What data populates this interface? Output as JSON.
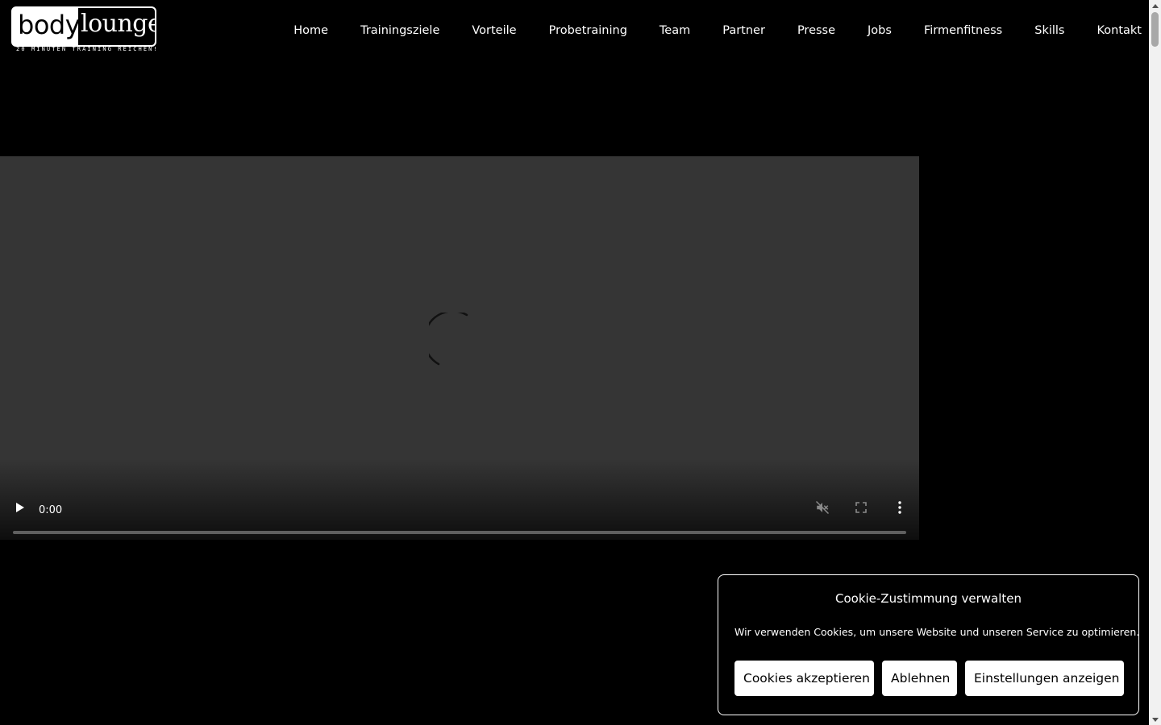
{
  "logo": {
    "word_left": "body",
    "word_right": "lounge",
    "tagline": "20 MINUTEN TRAINING REICHEN!"
  },
  "nav": {
    "items": [
      {
        "label": "Home"
      },
      {
        "label": "Trainingsziele"
      },
      {
        "label": "Vorteile"
      },
      {
        "label": "Probetraining"
      },
      {
        "label": "Team"
      },
      {
        "label": "Partner"
      },
      {
        "label": "Presse"
      },
      {
        "label": "Jobs"
      },
      {
        "label": "Firmenfitness"
      },
      {
        "label": "Skills"
      },
      {
        "label": "Kontakt"
      }
    ]
  },
  "video": {
    "time": "0:00",
    "progress": 0,
    "icons": {
      "play": "play-icon",
      "mute": "volume-muted-icon",
      "fullscreen": "fullscreen-icon",
      "more": "more-vertical-icon",
      "loading": "loading-spinner-icon"
    }
  },
  "cookie": {
    "title": "Cookie-Zustimmung verwalten",
    "text": "Wir verwenden Cookies, um unsere Website und unseren Service zu optimieren.",
    "accept_label": "Cookies akzeptieren",
    "deny_label": "Ablehnen",
    "settings_label": "Einstellungen anzeigen"
  },
  "colors": {
    "background": "#000000",
    "video_bg": "#353535",
    "text": "#ffffff",
    "button_bg": "#ffffff",
    "button_text": "#000000"
  }
}
